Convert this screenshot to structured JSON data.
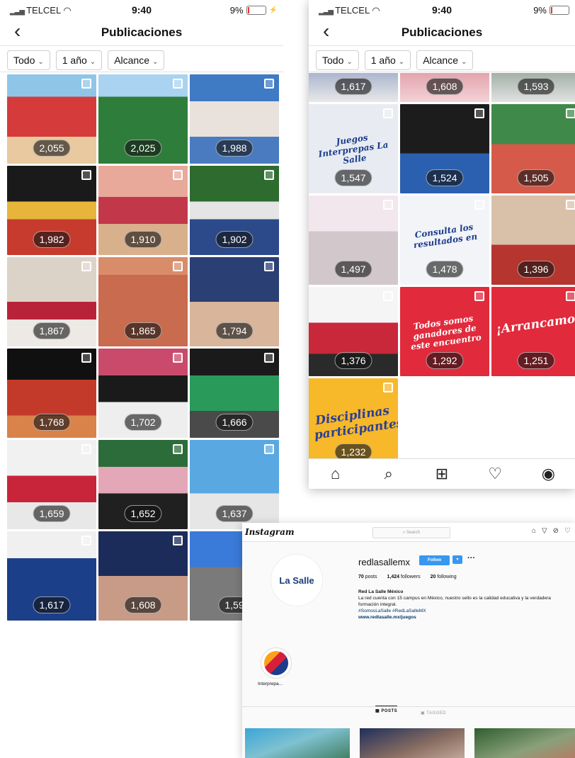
{
  "left_phone": {
    "status": {
      "carrier": "TELCEL",
      "time": "9:40",
      "battery": "9%"
    },
    "title": "Publicaciones",
    "filters": [
      "Todo",
      "1 año",
      "Alcance"
    ],
    "posts": [
      {
        "reach": "2,055"
      },
      {
        "reach": "2,025"
      },
      {
        "reach": "1,988"
      },
      {
        "reach": "1,982"
      },
      {
        "reach": "1,910"
      },
      {
        "reach": "1,902"
      },
      {
        "reach": "1,867"
      },
      {
        "reach": "1,865"
      },
      {
        "reach": "1,794"
      },
      {
        "reach": "1,768"
      },
      {
        "reach": "1,702"
      },
      {
        "reach": "1,666"
      },
      {
        "reach": "1,659"
      },
      {
        "reach": "1,652"
      },
      {
        "reach": "1,637"
      },
      {
        "reach": "1,617"
      },
      {
        "reach": "1,608"
      },
      {
        "reach": "1,59"
      }
    ]
  },
  "right_phone": {
    "status": {
      "carrier": "TELCEL",
      "time": "9:40",
      "battery": "9%"
    },
    "title": "Publicaciones",
    "filters": [
      "Todo",
      "1 año",
      "Alcance"
    ],
    "posts": [
      {
        "reach": "1,617"
      },
      {
        "reach": "1,608"
      },
      {
        "reach": "1,593"
      },
      {
        "reach": "1,547",
        "text": "Juegos Interprepas La Salle"
      },
      {
        "reach": "1,524"
      },
      {
        "reach": "1,505"
      },
      {
        "reach": "1,497"
      },
      {
        "reach": "1,478",
        "text": "Consulta los resultados en"
      },
      {
        "reach": "1,396"
      },
      {
        "reach": "1,376"
      },
      {
        "reach": "1,292",
        "text": "Todos somos ganadores de este encuentro"
      },
      {
        "reach": "1,251",
        "text": "¡Arrancamos!"
      },
      {
        "reach": "1,232",
        "text": "Disciplinas participantes"
      }
    ],
    "tabbar_icons": [
      "home-icon",
      "search-icon",
      "add-post-icon",
      "heart-icon",
      "profile-icon"
    ]
  },
  "web_profile": {
    "brand": "Instagram",
    "search_placeholder": "Search",
    "username": "redlasallemx",
    "follow_label": "Follow",
    "posts_count": "70",
    "posts_label": "posts",
    "followers_count": "1,424",
    "followers_label": "followers",
    "following_count": "20",
    "following_label": "following",
    "full_name": "Red La Salle México",
    "bio": "La red cuenta con 15 campus en México, nuestro sello es la calidad educativa y la verdadera formación integral.",
    "hashtags": "#SomosLaSalle #RedLaSalleMX",
    "link": "www.redlasalle.mx/juegos",
    "logo_text": "La Salle",
    "highlight_label": "Interprepa...",
    "tab_posts": "POSTS",
    "tab_tagged": "TAGGED"
  }
}
